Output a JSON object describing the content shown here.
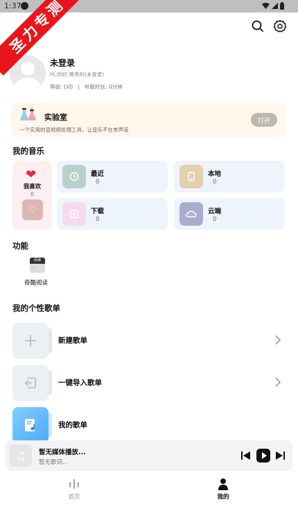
{
  "status_bar": {
    "time": "1:37"
  },
  "watermark": {
    "text": "圣力专测"
  },
  "profile": {
    "name": "未登录",
    "greeting": "Hi,你好,尊贵的(未登录)",
    "level": "等级: LV0",
    "separator": "|",
    "listen_time": "听歌时长: 0分钟"
  },
  "lab": {
    "title": "实验室",
    "desc": "一个实用的音视频处理工具，让音乐不在单声道",
    "button": "打开"
  },
  "my_music": {
    "title": "我的音乐",
    "favorites": {
      "label": "我喜欢",
      "count": "0"
    },
    "cards": [
      {
        "label": "最近",
        "count": "0",
        "color": "#b9d1c9"
      },
      {
        "label": "本地",
        "count": "0",
        "color": "#e3d0ae"
      },
      {
        "label": "下载",
        "count": "0",
        "color": "#f4dcec"
      },
      {
        "label": "云端",
        "count": "0",
        "color": "#abaccc"
      }
    ]
  },
  "functions": {
    "title": "功能",
    "items": [
      {
        "label": "奇酷阅读",
        "icon_text": "阅读"
      }
    ]
  },
  "playlists": {
    "title": "我的个性歌单",
    "items": [
      {
        "label": "新建歌单"
      },
      {
        "label": "一键导入歌单"
      },
      {
        "label": "我的歌单"
      }
    ]
  },
  "player": {
    "title": "暂无媒体播放...",
    "lyric": "暂无歌词.."
  },
  "tabs": [
    {
      "label": "首页",
      "active": false
    },
    {
      "label": "我的",
      "active": true
    }
  ]
}
